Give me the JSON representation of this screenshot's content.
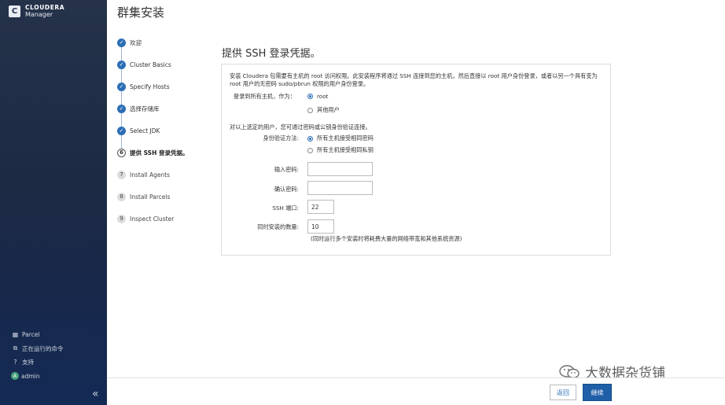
{
  "brand": {
    "top": "CLOUDERA",
    "bottom": "Manager",
    "logo_letter": "C"
  },
  "title": "群集安装",
  "steps": [
    {
      "label": "欢迎",
      "state": "done",
      "marker": "✓"
    },
    {
      "label": "Cluster Basics",
      "state": "done",
      "marker": "✓"
    },
    {
      "label": "Specify Hosts",
      "state": "done",
      "marker": "✓"
    },
    {
      "label": "选择存储库",
      "state": "done",
      "marker": "✓"
    },
    {
      "label": "Select JDK",
      "state": "done",
      "marker": "✓"
    },
    {
      "label": "提供 SSH 登录凭据。",
      "state": "current",
      "marker": "6"
    },
    {
      "label": "Install Agents",
      "state": "todo",
      "marker": "7"
    },
    {
      "label": "Install Parcels",
      "state": "todo",
      "marker": "8"
    },
    {
      "label": "Inspect Cluster",
      "state": "todo",
      "marker": "9"
    }
  ],
  "sidebar": {
    "items": [
      {
        "icon": "parcel-icon",
        "label": "Parcel"
      },
      {
        "icon": "commands-icon",
        "label": "正在运行的命令"
      },
      {
        "icon": "help-icon",
        "label": "支持"
      },
      {
        "icon": "avatar-icon",
        "label": "admin",
        "avatar_letter": "A"
      }
    ],
    "collapse": "«"
  },
  "panel": {
    "title": "提供 SSH 登录凭据。",
    "intro": "安装 Cloudera 包需要有主机的 root 访问权限。此安装程序将通过 SSH 连接到您的主机，然后直接以 root 用户身份登录，或者以另一个具有变为 root 用户的无密码 sudo/pbrun 权限的用户身份登录。",
    "login_label": "登录到所有主机，作为：",
    "login_options": [
      "root",
      "其他用户"
    ],
    "auth_intro": "对以上选定的用户，您可通过密码或公钥身份验证连接。",
    "auth_label": "身份验证方法:",
    "auth_options": [
      "所有主机接受相同密码",
      "所有主机接受相同私钥"
    ],
    "password_label": "输入密码:",
    "password_value": "",
    "confirm_label": "确认密码:",
    "confirm_value": "",
    "ssh_port_label": "SSH 端口:",
    "ssh_port_value": "22",
    "concurrent_label": "同时安装的数量:",
    "concurrent_value": "10",
    "concurrent_hint": "(同时运行多个安装时将耗费大量的网络带宽和其他系统资源)"
  },
  "footer": {
    "back": "返回",
    "next": "继续"
  },
  "watermark": {
    "text": "大数据杂货铺"
  },
  "colors": {
    "sidebar": "#1d2a44",
    "accent": "#2c6eb5",
    "primary_button": "#1f5fa8"
  }
}
